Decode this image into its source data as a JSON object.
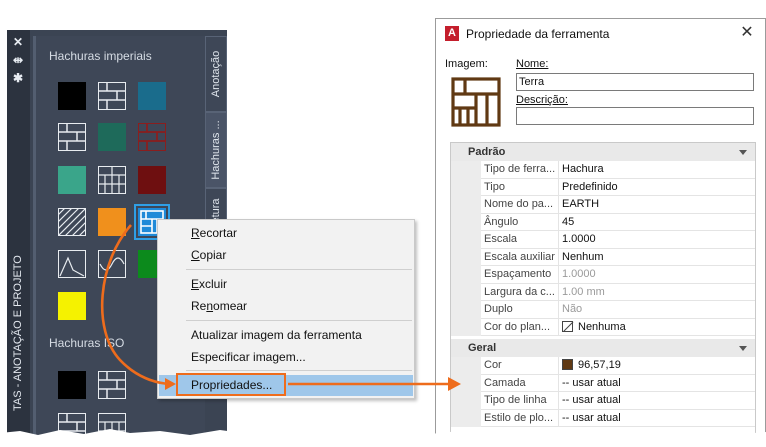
{
  "palette": {
    "vertical_title": "TAS - ANOTAÇÃO E PROJETO",
    "groups": [
      {
        "title": "Hachuras imperiais"
      },
      {
        "title": "Hachuras ISO"
      }
    ],
    "tabs": [
      {
        "label": "Anotação"
      },
      {
        "label": "Hachuras ..."
      },
      {
        "label": "etura"
      }
    ],
    "strip_icons": [
      "close-icon",
      "autohide-icon",
      "properties-icon"
    ]
  },
  "context_menu": {
    "items": [
      {
        "label": "Recortar",
        "shortcut_letter": "R"
      },
      {
        "label": "Copiar",
        "shortcut_letter": "C"
      },
      {
        "label": "Excluir",
        "shortcut_letter": "E"
      },
      {
        "label": "Renomear",
        "shortcut_letter": "n"
      },
      {
        "label": "Atualizar imagem da ferramenta"
      },
      {
        "label": "Especificar imagem..."
      },
      {
        "label": "Propriedades...",
        "highlighted": true
      }
    ]
  },
  "dialog": {
    "title": "Propriedade da ferramenta",
    "close_symbol": "✕",
    "image_label": "Imagem:",
    "name_label": "Nome:",
    "name_value": "Terra",
    "description_label": "Descrição:",
    "description_value": "",
    "categories": [
      {
        "title": "Padrão",
        "rows": [
          {
            "name": "Tipo de ferra...",
            "value": "Hachura"
          },
          {
            "name": "Tipo",
            "value": "Predefinido"
          },
          {
            "name": "Nome do pa...",
            "value": "EARTH"
          },
          {
            "name": "Ângulo",
            "value": "45"
          },
          {
            "name": "Escala",
            "value": "1.0000"
          },
          {
            "name": "Escala auxiliar",
            "value": "Nenhum"
          },
          {
            "name": "Espaçamento",
            "value": "1.0000",
            "disabled": true
          },
          {
            "name": "Largura da c...",
            "value": "1.00 mm",
            "disabled": true
          },
          {
            "name": "Duplo",
            "value": "Não",
            "disabled": true
          },
          {
            "name": "Cor do plan...",
            "value": "Nenhuma",
            "swatch": "none"
          }
        ]
      },
      {
        "title": "Geral",
        "rows": [
          {
            "name": "Cor",
            "value": "96,57,19",
            "swatch": "#603913"
          },
          {
            "name": "Camada",
            "value": "-- usar atual"
          },
          {
            "name": "Tipo de linha",
            "value": "-- usar atual"
          },
          {
            "name": "Estilo de plo...",
            "value": "-- usar atual"
          }
        ]
      }
    ]
  },
  "colors": {
    "palette_bg": "#3b4453",
    "selection_blue": "#1f8ad8",
    "callout_orange": "#ee6c1c",
    "menu_highlight": "#9fc7ea",
    "earth_brown": "#603913",
    "autodesk_red": "#c41e2c"
  }
}
